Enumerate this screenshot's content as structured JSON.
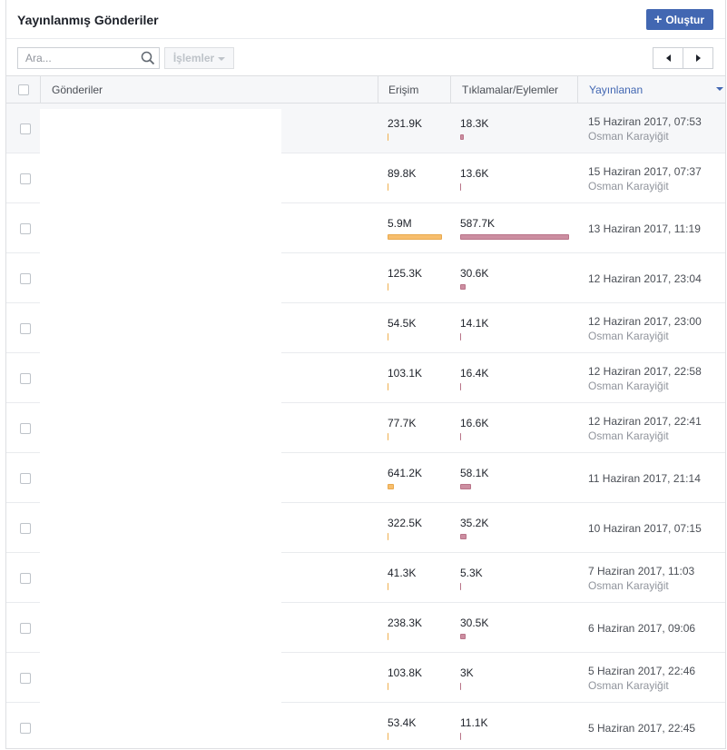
{
  "header": {
    "title": "Yayınlanmış Gönderiler",
    "create_label": "Oluştur"
  },
  "toolbar": {
    "search_placeholder": "Ara...",
    "actions_label": "İşlemler"
  },
  "table": {
    "columns": {
      "posts": "Gönderiler",
      "reach": "Erişim",
      "clicks": "Tıklamalar/Eylemler",
      "published": "Yayınlanan"
    },
    "rows": [
      {
        "reach": "231.9K",
        "clicks": "18.3K",
        "date": "15 Haziran 2017, 07:53",
        "author": "Osman Karayiğit",
        "reach_pct": 3.9,
        "click_pct": 3.1
      },
      {
        "reach": "89.8K",
        "clicks": "13.6K",
        "date": "15 Haziran 2017, 07:37",
        "author": "Osman Karayiğit",
        "reach_pct": 1.5,
        "click_pct": 2.3
      },
      {
        "reach": "5.9M",
        "clicks": "587.7K",
        "date": "13 Haziran 2017, 11:19",
        "author": "",
        "reach_pct": 100,
        "click_pct": 100
      },
      {
        "reach": "125.3K",
        "clicks": "30.6K",
        "date": "12 Haziran 2017, 23:04",
        "author": "",
        "reach_pct": 2.1,
        "click_pct": 5.2
      },
      {
        "reach": "54.5K",
        "clicks": "14.1K",
        "date": "12 Haziran 2017, 23:00",
        "author": "Osman Karayiğit",
        "reach_pct": 0.9,
        "click_pct": 2.4
      },
      {
        "reach": "103.1K",
        "clicks": "16.4K",
        "date": "12 Haziran 2017, 22:58",
        "author": "Osman Karayiğit",
        "reach_pct": 1.7,
        "click_pct": 2.8
      },
      {
        "reach": "77.7K",
        "clicks": "16.6K",
        "date": "12 Haziran 2017, 22:41",
        "author": "Osman Karayiğit",
        "reach_pct": 1.3,
        "click_pct": 2.8
      },
      {
        "reach": "641.2K",
        "clicks": "58.1K",
        "date": "11 Haziran 2017, 21:14",
        "author": "",
        "reach_pct": 10.9,
        "click_pct": 9.9
      },
      {
        "reach": "322.5K",
        "clicks": "35.2K",
        "date": "10 Haziran 2017, 07:15",
        "author": "",
        "reach_pct": 5.5,
        "click_pct": 6.0
      },
      {
        "reach": "41.3K",
        "clicks": "5.3K",
        "date": "7 Haziran 2017, 11:03",
        "author": "Osman Karayiğit",
        "reach_pct": 0.7,
        "click_pct": 0.9
      },
      {
        "reach": "238.3K",
        "clicks": "30.5K",
        "date": "6 Haziran 2017, 09:06",
        "author": "",
        "reach_pct": 4.0,
        "click_pct": 5.2
      },
      {
        "reach": "103.8K",
        "clicks": "3K",
        "date": "5 Haziran 2017, 22:46",
        "author": "Osman Karayiğit",
        "reach_pct": 1.8,
        "click_pct": 0.5
      },
      {
        "reach": "53.4K",
        "clicks": "11.1K",
        "date": "5 Haziran 2017, 22:45",
        "author": "",
        "reach_pct": 0.9,
        "click_pct": 1.9
      }
    ]
  },
  "colors": {
    "accent": "#4267b2",
    "reach_bar": "#f7be6d",
    "click_bar": "#cc8ea1"
  }
}
